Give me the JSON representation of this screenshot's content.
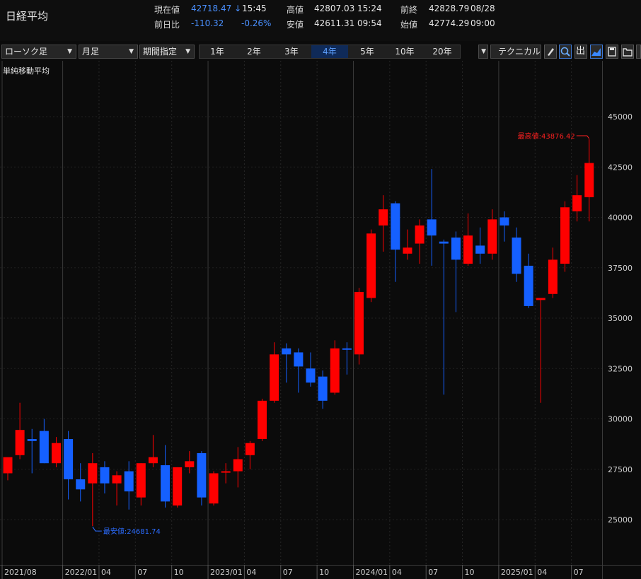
{
  "header": {
    "title": "日経平均",
    "labels": {
      "current": "現在値",
      "change": "前日比",
      "high": "高値",
      "low": "安値",
      "prev_close": "前終",
      "open": "始値"
    },
    "current_value": "42718.47 ↓",
    "current_time": "15:45",
    "change_value": "-110.32",
    "change_pct": "-0.26%",
    "high_value": "42807.03",
    "high_time": "15:24",
    "low_value": "42611.31",
    "low_time": "09:54",
    "prev_close_value": "42828.79",
    "prev_close_date": "08/28",
    "open_value": "42774.29",
    "open_time": "09:00"
  },
  "toolbar": {
    "chart_type": "ローソク足",
    "interval": "月足",
    "period": "期間指定",
    "ranges": [
      "1年",
      "2年",
      "3年",
      "4年",
      "5年",
      "10年",
      "20年"
    ],
    "active_range": "4年",
    "technical": "テクニカル",
    "icons": [
      "pencil-icon",
      "zoom-icon",
      "output-icon",
      "chart-icon",
      "save-icon",
      "folder-icon",
      "more-icon"
    ]
  },
  "indicator_label": "単純移動平均",
  "colors": {
    "up": "#ff0000",
    "down": "#1560ff",
    "grid": "#2a2a2a",
    "text": "#d0d0d0",
    "low_label": "#2b6cff",
    "high_label": "#ff2020"
  },
  "chart_data": {
    "type": "candlestick",
    "x_labels": [
      "2021/08",
      "2022/01",
      "04",
      "07",
      "10",
      "2023/01",
      "04",
      "07",
      "10",
      "2024/01",
      "04",
      "07",
      "10",
      "2025/01",
      "04",
      "07"
    ],
    "y_ticks": [
      25000,
      27500,
      30000,
      32500,
      35000,
      37500,
      40000,
      42500,
      45000
    ],
    "ylim": [
      23700,
      46500
    ],
    "annotations": {
      "high": "最高値:43876.42",
      "low": "最安値:24681.74"
    },
    "candles": [
      {
        "date": "2021/08",
        "o": 27300,
        "h": 28000,
        "l": 26950,
        "c": 28100
      },
      {
        "date": "2021/09",
        "o": 28200,
        "h": 30800,
        "l": 28000,
        "c": 29450
      },
      {
        "date": "2021/10",
        "o": 29000,
        "h": 29500,
        "l": 27300,
        "c": 28900
      },
      {
        "date": "2021/11",
        "o": 29400,
        "h": 30000,
        "l": 27800,
        "c": 27800
      },
      {
        "date": "2021/12",
        "o": 27800,
        "h": 29100,
        "l": 27600,
        "c": 28800
      },
      {
        "date": "2022/01",
        "o": 29000,
        "h": 29400,
        "l": 26000,
        "c": 27000
      },
      {
        "date": "2022/02",
        "o": 27000,
        "h": 27800,
        "l": 25900,
        "c": 26500
      },
      {
        "date": "2022/03",
        "o": 26800,
        "h": 28300,
        "l": 24681.74,
        "c": 27800
      },
      {
        "date": "2022/04",
        "o": 27600,
        "h": 27900,
        "l": 26300,
        "c": 26800
      },
      {
        "date": "2022/05",
        "o": 26800,
        "h": 27400,
        "l": 25700,
        "c": 27200
      },
      {
        "date": "2022/06",
        "o": 27400,
        "h": 27900,
        "l": 25500,
        "c": 26400
      },
      {
        "date": "2022/07",
        "o": 26100,
        "h": 27800,
        "l": 25700,
        "c": 27800
      },
      {
        "date": "2022/08",
        "o": 27800,
        "h": 29200,
        "l": 27600,
        "c": 28100
      },
      {
        "date": "2022/09",
        "o": 27700,
        "h": 28700,
        "l": 25600,
        "c": 25900
      },
      {
        "date": "2022/10",
        "o": 25700,
        "h": 27600,
        "l": 25600,
        "c": 27600
      },
      {
        "date": "2022/11",
        "o": 27600,
        "h": 28400,
        "l": 27300,
        "c": 27900
      },
      {
        "date": "2022/12",
        "o": 28300,
        "h": 28400,
        "l": 25700,
        "c": 26100
      },
      {
        "date": "2023/01",
        "o": 25800,
        "h": 27400,
        "l": 25700,
        "c": 27300
      },
      {
        "date": "2023/02",
        "o": 27400,
        "h": 27800,
        "l": 26800,
        "c": 27400
      },
      {
        "date": "2023/03",
        "o": 27400,
        "h": 28600,
        "l": 26600,
        "c": 28000
      },
      {
        "date": "2023/04",
        "o": 28200,
        "h": 28900,
        "l": 27500,
        "c": 28800
      },
      {
        "date": "2023/05",
        "o": 29000,
        "h": 31000,
        "l": 28900,
        "c": 30900
      },
      {
        "date": "2023/06",
        "o": 30900,
        "h": 33800,
        "l": 30800,
        "c": 33200
      },
      {
        "date": "2023/07",
        "o": 33500,
        "h": 33750,
        "l": 31800,
        "c": 33200
      },
      {
        "date": "2023/08",
        "o": 33300,
        "h": 33500,
        "l": 31300,
        "c": 32600
      },
      {
        "date": "2023/09",
        "o": 32500,
        "h": 33300,
        "l": 31600,
        "c": 31800
      },
      {
        "date": "2023/10",
        "o": 32100,
        "h": 32400,
        "l": 30500,
        "c": 30900
      },
      {
        "date": "2023/11",
        "o": 31300,
        "h": 33900,
        "l": 31200,
        "c": 33500
      },
      {
        "date": "2023/12",
        "o": 33500,
        "h": 33800,
        "l": 32200,
        "c": 33460
      },
      {
        "date": "2024/01",
        "o": 33200,
        "h": 36500,
        "l": 32700,
        "c": 36300
      },
      {
        "date": "2024/02",
        "o": 36000,
        "h": 39400,
        "l": 35800,
        "c": 39200
      },
      {
        "date": "2024/03",
        "o": 39600,
        "h": 41100,
        "l": 38300,
        "c": 40400
      },
      {
        "date": "2024/04",
        "o": 40700,
        "h": 40800,
        "l": 36800,
        "c": 38400
      },
      {
        "date": "2024/05",
        "o": 38200,
        "h": 39400,
        "l": 37900,
        "c": 38500
      },
      {
        "date": "2024/06",
        "o": 38700,
        "h": 39900,
        "l": 37700,
        "c": 39600
      },
      {
        "date": "2024/07",
        "o": 39900,
        "h": 42400,
        "l": 37600,
        "c": 39100
      },
      {
        "date": "2024/08",
        "o": 38800,
        "h": 38900,
        "l": 31200,
        "c": 38700
      },
      {
        "date": "2024/09",
        "o": 39000,
        "h": 39300,
        "l": 35300,
        "c": 37900
      },
      {
        "date": "2024/10",
        "o": 37700,
        "h": 40200,
        "l": 37600,
        "c": 39100
      },
      {
        "date": "2024/11",
        "o": 38600,
        "h": 39500,
        "l": 37700,
        "c": 38200
      },
      {
        "date": "2024/12",
        "o": 38200,
        "h": 40400,
        "l": 37900,
        "c": 39900
      },
      {
        "date": "2025/01",
        "o": 40000,
        "h": 40300,
        "l": 38800,
        "c": 39600
      },
      {
        "date": "2025/02",
        "o": 39000,
        "h": 39500,
        "l": 36800,
        "c": 37200
      },
      {
        "date": "2025/03",
        "o": 37600,
        "h": 38200,
        "l": 35500,
        "c": 35600
      },
      {
        "date": "2025/04",
        "o": 35900,
        "h": 36000,
        "l": 30800,
        "c": 36000
      },
      {
        "date": "2025/05",
        "o": 36200,
        "h": 38500,
        "l": 36000,
        "c": 37900
      },
      {
        "date": "2025/06",
        "o": 37700,
        "h": 40800,
        "l": 37300,
        "c": 40500
      },
      {
        "date": "2025/07",
        "o": 40300,
        "h": 42100,
        "l": 39800,
        "c": 41100
      },
      {
        "date": "2025/08",
        "o": 41000,
        "h": 43876.42,
        "l": 39800,
        "c": 42700
      }
    ]
  }
}
